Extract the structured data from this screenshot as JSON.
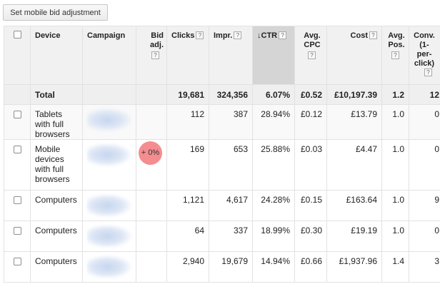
{
  "toolbar": {
    "bid_button_label": "Set mobile bid adjustment"
  },
  "colors": {
    "sorted_header": "#d5d5d5",
    "bid_highlight": "#f48d8f",
    "header_bg": "#f1f1f1"
  },
  "headers": {
    "device": "Device",
    "campaign": "Campaign",
    "bid_adj": "Bid adj.",
    "clicks": "Clicks",
    "impr": "Impr.",
    "ctr": "CTR",
    "ctr_sort_arrow": "↓",
    "avg_cpc": "Avg. CPC",
    "cost": "Cost",
    "avg_pos": "Avg. Pos.",
    "conv": "Conv. (1-per-click)",
    "help_glyph": "?"
  },
  "total": {
    "label": "Total",
    "clicks": "19,681",
    "impr": "324,356",
    "ctr": "6.07%",
    "avg_cpc": "£0.52",
    "cost": "£10,197.39",
    "avg_pos": "1.2",
    "conv": "12"
  },
  "rows": [
    {
      "device": "Tablets with full browsers",
      "bid_adj": "",
      "clicks": "112",
      "impr": "387",
      "ctr": "28.94%",
      "avg_cpc": "£0.12",
      "cost": "£13.79",
      "avg_pos": "1.0",
      "conv": "0"
    },
    {
      "device": "Mobile devices with full browsers",
      "bid_adj": "+ 0%",
      "clicks": "169",
      "impr": "653",
      "ctr": "25.88%",
      "avg_cpc": "£0.03",
      "cost": "£4.47",
      "avg_pos": "1.0",
      "conv": "0"
    },
    {
      "device": "Computers",
      "bid_adj": "",
      "clicks": "1,121",
      "impr": "4,617",
      "ctr": "24.28%",
      "avg_cpc": "£0.15",
      "cost": "£163.64",
      "avg_pos": "1.0",
      "conv": "9"
    },
    {
      "device": "Computers",
      "bid_adj": "",
      "clicks": "64",
      "impr": "337",
      "ctr": "18.99%",
      "avg_cpc": "£0.30",
      "cost": "£19.19",
      "avg_pos": "1.0",
      "conv": "0"
    },
    {
      "device": "Computers",
      "bid_adj": "",
      "clicks": "2,940",
      "impr": "19,679",
      "ctr": "14.94%",
      "avg_cpc": "£0.66",
      "cost": "£1,937.96",
      "avg_pos": "1.4",
      "conv": "3"
    }
  ]
}
